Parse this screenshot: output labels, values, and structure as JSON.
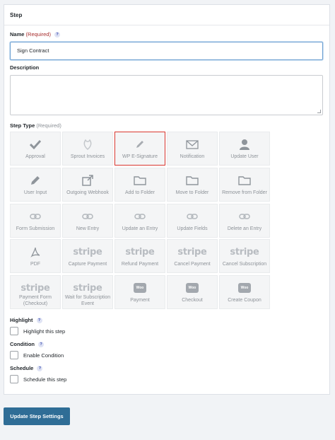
{
  "panel": {
    "title": "Step"
  },
  "name_field": {
    "label": "Name",
    "required": "(Required)",
    "help": "?",
    "value": "Sign Contract"
  },
  "description_field": {
    "label": "Description",
    "value": ""
  },
  "step_type": {
    "label": "Step Type",
    "required": "(Required)",
    "selected": "WP E-Signature",
    "items": [
      {
        "label": "Approval",
        "icon": "check-icon"
      },
      {
        "label": "Sprout Invoices",
        "icon": "sprout-icon"
      },
      {
        "label": "WP E-Signature",
        "icon": "pen-icon"
      },
      {
        "label": "Notification",
        "icon": "envelope-icon"
      },
      {
        "label": "Update User",
        "icon": "user-icon"
      },
      {
        "label": "User Input",
        "icon": "pencil-icon"
      },
      {
        "label": "Outgoing Webhook",
        "icon": "external-link-icon"
      },
      {
        "label": "Add to Folder",
        "icon": "folder-icon"
      },
      {
        "label": "Move to Folder",
        "icon": "folder-icon"
      },
      {
        "label": "Remove from Folder",
        "icon": "folder-icon"
      },
      {
        "label": "Form Submission",
        "icon": "link-icon"
      },
      {
        "label": "New Entry",
        "icon": "link-icon"
      },
      {
        "label": "Update an Entry",
        "icon": "link-icon"
      },
      {
        "label": "Update Fields",
        "icon": "link-icon"
      },
      {
        "label": "Delete an Entry",
        "icon": "link-icon"
      },
      {
        "label": "PDF",
        "icon": "pdf-icon"
      },
      {
        "label": "Capture Payment",
        "icon": "stripe-logo",
        "logo_text": "stripe"
      },
      {
        "label": "Refund Payment",
        "icon": "stripe-logo",
        "logo_text": "stripe"
      },
      {
        "label": "Cancel Payment",
        "icon": "stripe-logo",
        "logo_text": "stripe"
      },
      {
        "label": "Cancel Subscription",
        "icon": "stripe-logo",
        "logo_text": "stripe"
      },
      {
        "label": "Payment Form (Checkout)",
        "icon": "stripe-logo",
        "logo_text": "stripe"
      },
      {
        "label": "Wait for Subscription Event",
        "icon": "stripe-logo",
        "logo_text": "stripe"
      },
      {
        "label": "Payment",
        "icon": "woo-logo",
        "logo_text": "Woo"
      },
      {
        "label": "Checkout",
        "icon": "woo-logo",
        "logo_text": "Woo"
      },
      {
        "label": "Create Coupon",
        "icon": "woo-logo",
        "logo_text": "Woo"
      }
    ]
  },
  "highlight": {
    "label": "Highlight",
    "help": "?",
    "option": "Highlight this step",
    "checked": false
  },
  "condition": {
    "label": "Condition",
    "help": "?",
    "option": "Enable Condition",
    "checked": false
  },
  "schedule": {
    "label": "Schedule",
    "help": "?",
    "option": "Schedule this step",
    "checked": false
  },
  "update_button": {
    "label": "Update Step Settings"
  },
  "colors": {
    "accent": "#2f6d96",
    "selected_border": "#d9362f",
    "required": "#a72d2d"
  }
}
